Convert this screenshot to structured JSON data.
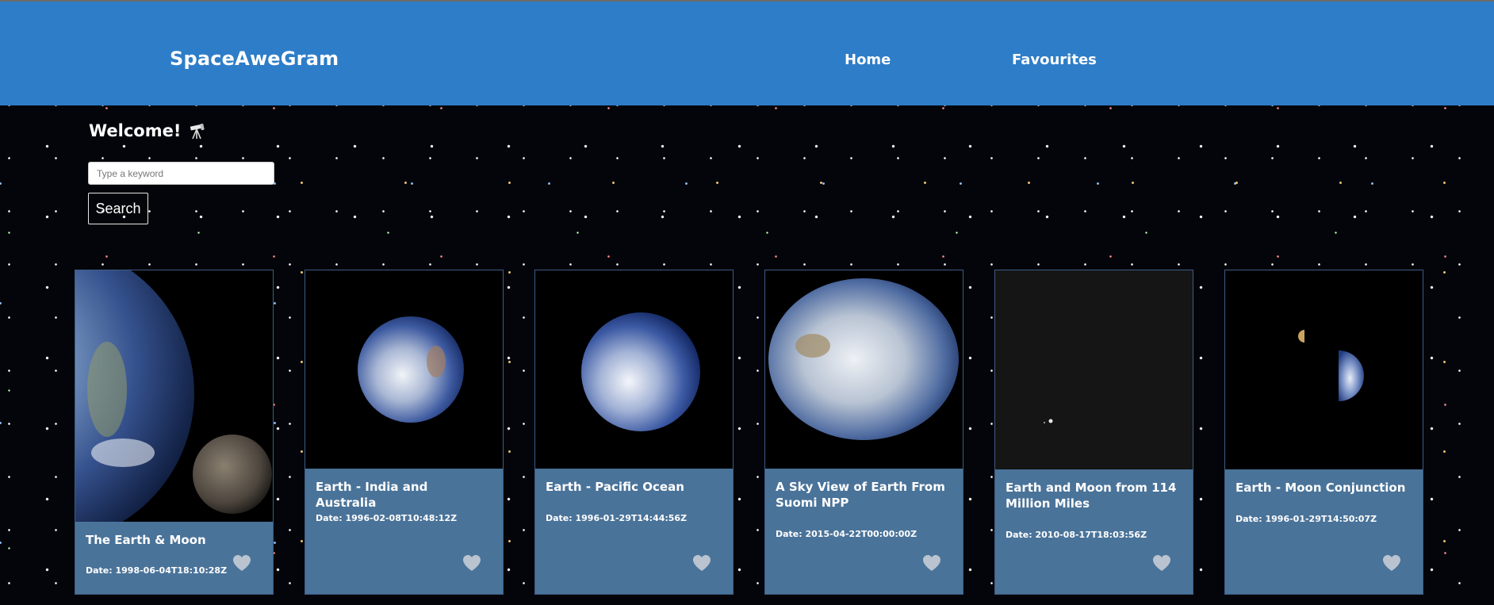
{
  "header": {
    "brand": "SpaceAweGram",
    "nav": [
      {
        "label": "Home"
      },
      {
        "label": "Favourites"
      }
    ]
  },
  "welcome": {
    "text": "Welcome!",
    "icon": "telescope-icon"
  },
  "search": {
    "placeholder": "Type a keyword",
    "value": "",
    "button_label": "Search"
  },
  "colors": {
    "header": "#2e7dc8",
    "card_body": "#4a7399",
    "heart": "#b9c4d0"
  },
  "cards": [
    {
      "title": "The Earth & Moon",
      "date": "Date: 1998-06-04T18:10:28Z",
      "liked": false
    },
    {
      "title": "Earth - India and Australia",
      "date": "Date: 1996-02-08T10:48:12Z",
      "liked": false
    },
    {
      "title": "Earth - Pacific Ocean",
      "date": "Date: 1996-01-29T14:44:56Z",
      "liked": false
    },
    {
      "title": "A Sky View of Earth From Suomi NPP",
      "date": "Date: 2015-04-22T00:00:00Z",
      "liked": false
    },
    {
      "title": "Earth and Moon from 114 Million Miles",
      "date": "Date: 2010-08-17T18:03:56Z",
      "liked": false
    },
    {
      "title": "Earth - Moon Conjunction",
      "date": "Date: 1996-01-29T14:50:07Z",
      "liked": false
    }
  ]
}
